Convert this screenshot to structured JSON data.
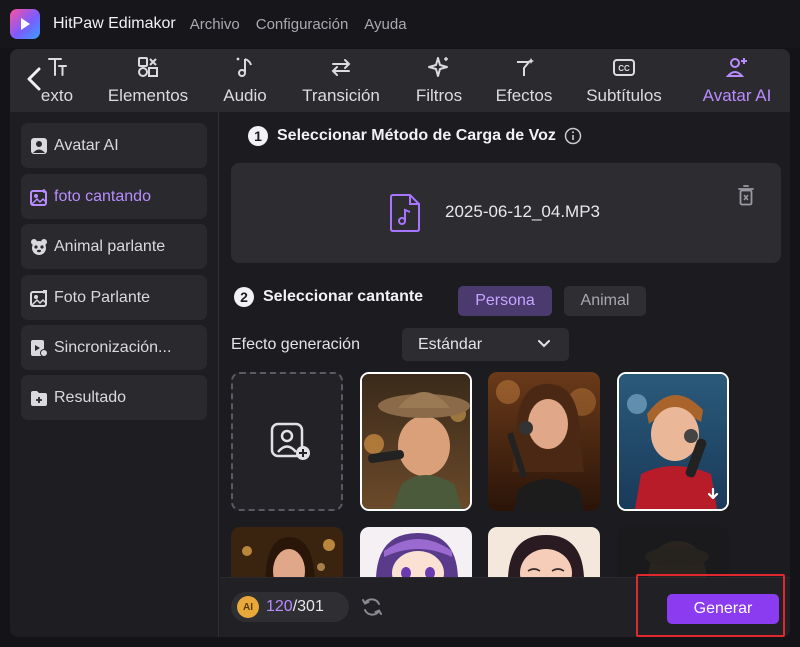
{
  "app": {
    "title": "HitPaw Edimakor",
    "menu": [
      "Archivo",
      "Configuración",
      "Ayuda"
    ]
  },
  "toolbar": {
    "tabs": [
      {
        "label": "exto",
        "icon": "text-icon"
      },
      {
        "label": "Elementos",
        "icon": "elements-icon"
      },
      {
        "label": "Audio",
        "icon": "music-note-icon"
      },
      {
        "label": "Transición",
        "icon": "transition-arrows-icon"
      },
      {
        "label": "Filtros",
        "icon": "sparkle-icon"
      },
      {
        "label": "Efectos",
        "icon": "magic-wand-icon"
      },
      {
        "label": "Subtítulos",
        "icon": "captions-icon"
      },
      {
        "label": "Avatar AI",
        "icon": "add-user-icon",
        "active": true
      }
    ]
  },
  "sidebar": {
    "items": [
      {
        "label": "Avatar AI",
        "icon": "avatar-icon"
      },
      {
        "label": "foto cantando",
        "icon": "singing-photo-icon",
        "active": true
      },
      {
        "label": "Animal parlante",
        "icon": "panda-icon"
      },
      {
        "label": "Foto Parlante",
        "icon": "talking-photo-icon"
      },
      {
        "label": "Sincronización...",
        "icon": "lip-sync-icon"
      },
      {
        "label": "Resultado",
        "icon": "folder-icon"
      }
    ]
  },
  "step1": {
    "number": "1",
    "title": "Seleccionar Método de Carga de Voz",
    "file_name": "2025-06-12_04.MP3"
  },
  "step2": {
    "number": "2",
    "title": "Seleccionar cantante",
    "options": [
      "Persona",
      "Animal"
    ],
    "selected": "Persona"
  },
  "effect": {
    "label": "Efecto generación",
    "value": "Estándar"
  },
  "footer": {
    "coin_label": "AI",
    "credits_used": "120",
    "credits_total": "/301",
    "generate_label": "Generar"
  },
  "colors": {
    "accent": "#8b3cf0",
    "accent_text": "#b98cff",
    "highlight": "#e0282e"
  }
}
